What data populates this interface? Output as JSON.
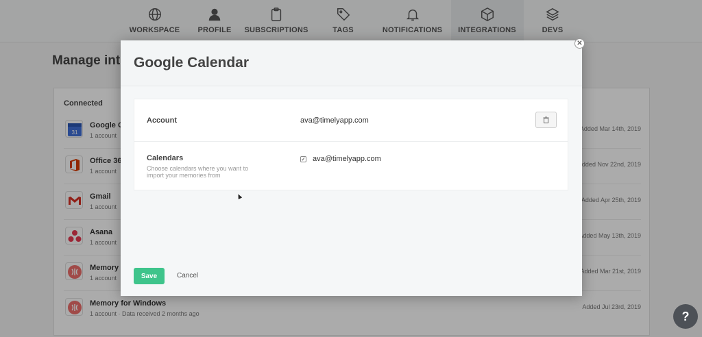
{
  "nav": {
    "items": [
      {
        "label": "WORKSPACE",
        "icon": "globe-icon"
      },
      {
        "label": "PROFILE",
        "icon": "user-icon"
      },
      {
        "label": "SUBSCRIPTIONS",
        "icon": "clipboard-icon"
      },
      {
        "label": "TAGS",
        "icon": "tag-icon"
      },
      {
        "label": "NOTIFICATIONS",
        "icon": "bell-icon"
      },
      {
        "label": "INTEGRATIONS",
        "icon": "cube-icon"
      },
      {
        "label": "DEVS",
        "icon": "layers-icon"
      }
    ],
    "active": "INTEGRATIONS"
  },
  "page": {
    "title": "Manage inte",
    "connected_heading": "Connected",
    "integrations": [
      {
        "name": "Google C",
        "meta": "1 account",
        "added": "Added Mar 14th, 2019",
        "icon": "google-calendar-icon"
      },
      {
        "name": "Office 36",
        "meta": "1 account",
        "added": "Added Nov 22nd, 2019",
        "icon": "office-icon"
      },
      {
        "name": "Gmail",
        "meta": "1 account",
        "added": "Added Apr 25th, 2019",
        "icon": "gmail-icon"
      },
      {
        "name": "Asana",
        "meta": "1 account",
        "added": "Added May 13th, 2019",
        "icon": "asana-icon"
      },
      {
        "name": "Memory",
        "meta": "1 account",
        "added": "Added Mar 21st, 2019",
        "icon": "memory-icon"
      },
      {
        "name": "Memory for Windows",
        "meta": "1 account  ·  Data received 2 months ago",
        "added": "Added Jul 23rd, 2019",
        "icon": "memory-icon"
      }
    ]
  },
  "modal": {
    "title": "Google Calendar",
    "account_label": "Account",
    "account_value": "ava@timelyapp.com",
    "calendars_label": "Calendars",
    "calendars_help": "Choose calendars where you want to import your memories from",
    "calendar_option": "ava@timelyapp.com",
    "calendar_checked": true,
    "save_label": "Save",
    "cancel_label": "Cancel"
  },
  "help": {
    "label": "?"
  },
  "colors": {
    "save": "#3ec48b",
    "overlay": "rgba(0,0,0,0.33)"
  }
}
